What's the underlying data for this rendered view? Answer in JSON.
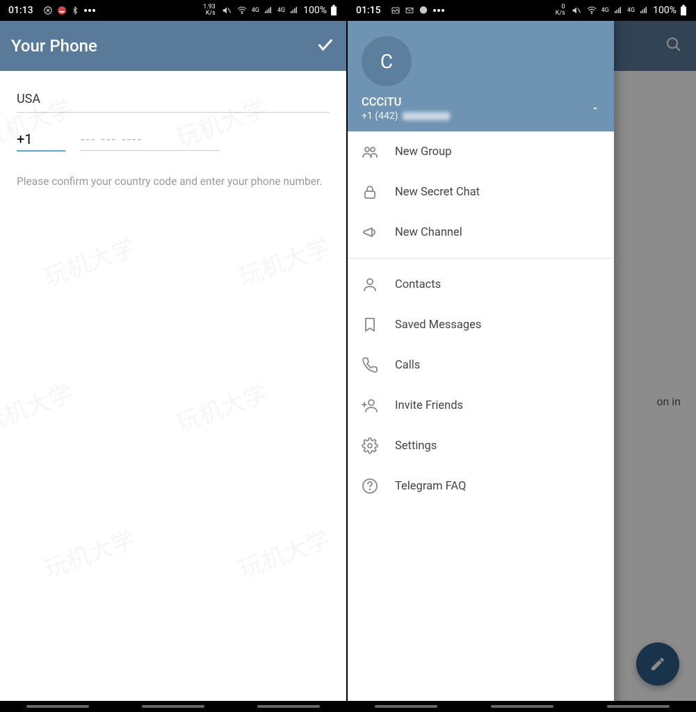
{
  "left": {
    "status": {
      "time": "01:13",
      "speed_up": "1.93",
      "speed_unit": "K/s",
      "net": "4G",
      "battery": "100%"
    },
    "appbar": {
      "title": "Your Phone"
    },
    "form": {
      "country": "USA",
      "country_code": "+1",
      "phone_placeholder": "--- --- ----",
      "hint": "Please confirm your country code and enter your phone number."
    }
  },
  "right": {
    "status": {
      "time": "01:15",
      "speed_up": "0",
      "speed_unit": "K/s",
      "net": "4G",
      "battery": "100%"
    },
    "visible_bg_text": "on in",
    "drawer": {
      "avatar_initial": "C",
      "username": "CCCiTU",
      "phone_prefix": "+1 (442)",
      "menu1": [
        {
          "id": "new-group",
          "label": "New Group"
        },
        {
          "id": "new-secret-chat",
          "label": "New Secret Chat"
        },
        {
          "id": "new-channel",
          "label": "New Channel"
        }
      ],
      "menu2": [
        {
          "id": "contacts",
          "label": "Contacts"
        },
        {
          "id": "saved-messages",
          "label": "Saved Messages"
        },
        {
          "id": "calls",
          "label": "Calls"
        },
        {
          "id": "invite-friends",
          "label": "Invite Friends"
        },
        {
          "id": "settings",
          "label": "Settings"
        },
        {
          "id": "telegram-faq",
          "label": "Telegram FAQ"
        }
      ]
    }
  },
  "icons": {
    "new-group": "group-icon",
    "new-secret-chat": "lock-icon",
    "new-channel": "megaphone-icon",
    "contacts": "person-icon",
    "saved-messages": "bookmark-icon",
    "calls": "phone-icon",
    "invite-friends": "invite-icon",
    "settings": "gear-icon",
    "telegram-faq": "help-icon"
  },
  "watermark_text": "玩机大学"
}
